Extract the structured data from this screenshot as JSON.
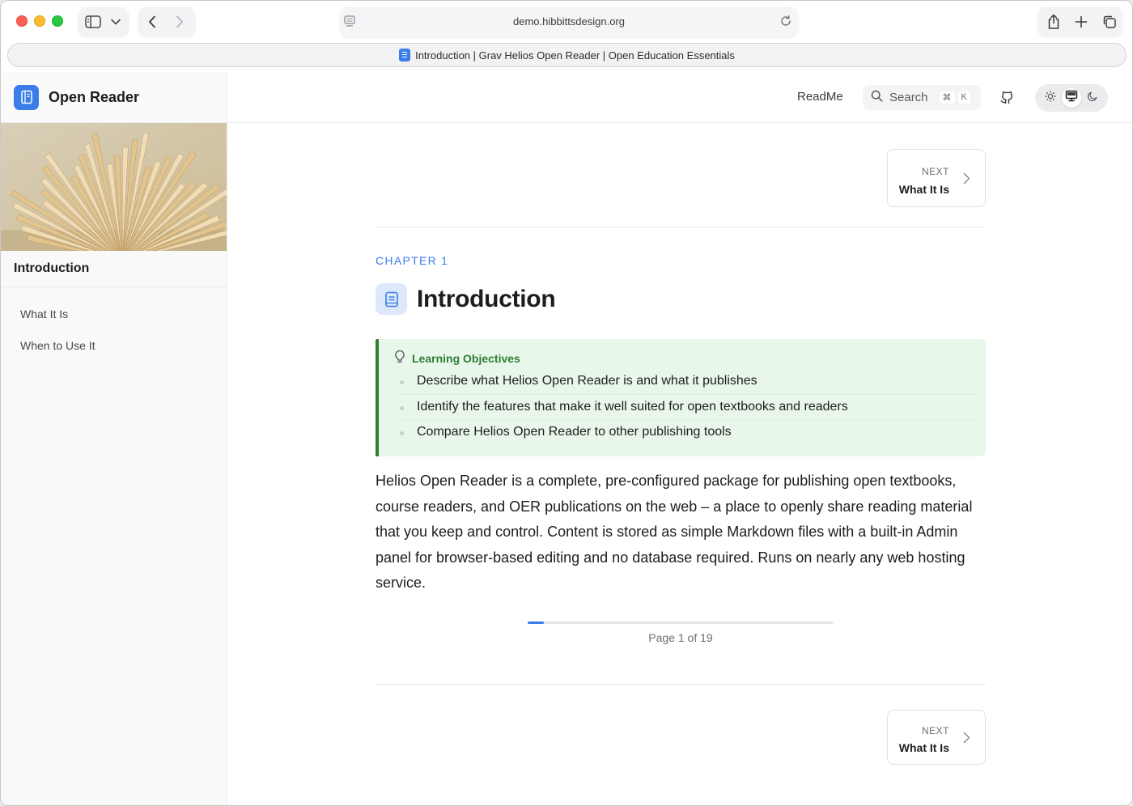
{
  "browser": {
    "url": "demo.hibbittsdesign.org",
    "tab_title": "Introduction | Grav Helios Open Reader | Open Education Essentials"
  },
  "site": {
    "brand_name": "Open Reader",
    "nav_readme": "ReadMe",
    "search_label": "Search",
    "search_shortcut_mod": "⌘",
    "search_shortcut_key": "K",
    "theme_active": "system"
  },
  "sidebar": {
    "section_title": "Introduction",
    "items": [
      {
        "label": "What It Is"
      },
      {
        "label": "When to Use It"
      }
    ]
  },
  "page": {
    "next_top": {
      "label": "NEXT",
      "title": "What It Is"
    },
    "chapter_label": "CHAPTER 1",
    "title": "Introduction",
    "objectives": {
      "heading": "Learning Objectives",
      "items": [
        "Describe what Helios Open Reader is and what it publishes",
        "Identify the features that make it well suited for open textbooks and readers",
        "Compare Helios Open Reader to other publishing tools"
      ]
    },
    "body": "Helios Open Reader is a complete, pre-configured package for publishing open textbooks, course readers, and OER publications on the web – a place to openly share reading material that you keep and control. Content is stored as simple Markdown files with a built-in Admin panel for browser-based editing and no database required. Runs on nearly any web hosting service.",
    "progress": {
      "current": 1,
      "total": 19,
      "label": "Page 1 of 19"
    },
    "next_bottom": {
      "label": "NEXT",
      "title": "What It Is"
    }
  },
  "colors": {
    "accent": "#3b7de9",
    "objectives_bg": "#e8f7ea",
    "objectives_accent": "#2e7d32"
  }
}
